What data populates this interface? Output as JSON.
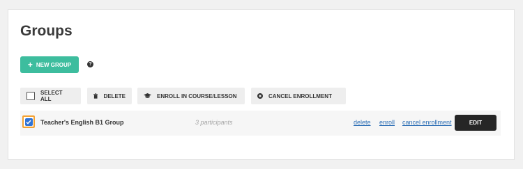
{
  "page": {
    "title": "Groups"
  },
  "actions": {
    "new_group_label": "NEW GROUP",
    "help_glyph": "?"
  },
  "toolbar": {
    "select_all_label": "SELECT ALL",
    "delete_label": "DELETE",
    "enroll_label": "ENROLL IN COURSE/LESSON",
    "cancel_enrollment_label": "CANCEL ENROLLMENT"
  },
  "groups": [
    {
      "name": "Teacher's English B1 Group",
      "participants": "3 participants",
      "checked": true,
      "links": {
        "delete": "delete",
        "enroll": "enroll",
        "cancel": "cancel enrollment"
      },
      "edit_label": "EDIT"
    }
  ],
  "colors": {
    "accent": "#3dbd9e",
    "checkbox": "#2f73d6",
    "highlight": "#f4a233",
    "link": "#2b6eb5",
    "edit_bg": "#262626"
  },
  "icons": [
    "plus-icon",
    "help-icon",
    "checkbox-icon",
    "trash-icon",
    "graduation-cap-icon",
    "cancel-circle-icon",
    "checkmark-icon"
  ]
}
